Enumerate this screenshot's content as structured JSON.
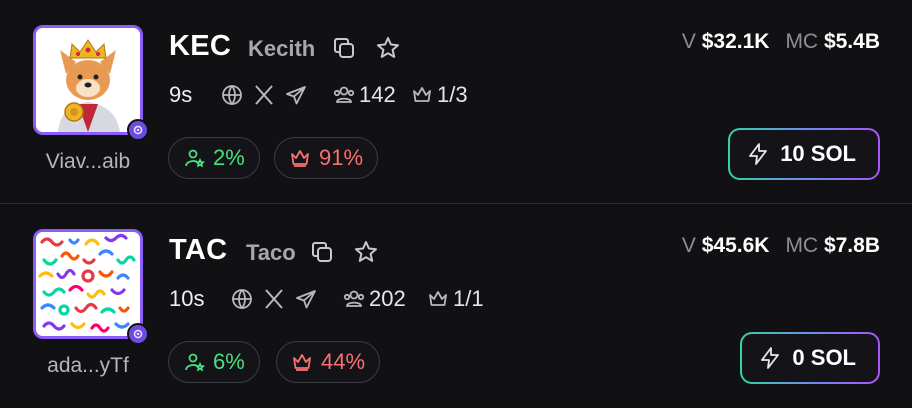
{
  "tokens": [
    {
      "ticker": "KEC",
      "name": "Kecith",
      "creator": "Viav...aib",
      "age": "9s",
      "holders": "142",
      "top_holders": "1/3",
      "dev_holding_pct": "2%",
      "top_holding_pct": "91%",
      "volume_label": "V",
      "volume": "$32.1K",
      "mcap_label": "MC",
      "mcap": "$5.4B",
      "buy_label": "10 SOL",
      "avatar_icon": "shiba-king-icon"
    },
    {
      "ticker": "TAC",
      "name": "Taco",
      "creator": "ada...yTf",
      "age": "10s",
      "holders": "202",
      "top_holders": "1/1",
      "dev_holding_pct": "6%",
      "top_holding_pct": "44%",
      "volume_label": "V",
      "volume": "$45.6K",
      "mcap_label": "MC",
      "mcap": "$7.8B",
      "buy_label": "0 SOL",
      "avatar_icon": "colorful-squiggles-icon"
    }
  ],
  "colors": {
    "background": "#111114",
    "avatar_border": "#8b5cf6",
    "positive": "#4ade80",
    "negative": "#f87171",
    "buy_gradient_start": "#34d3a0",
    "buy_gradient_end": "#a855f7"
  }
}
